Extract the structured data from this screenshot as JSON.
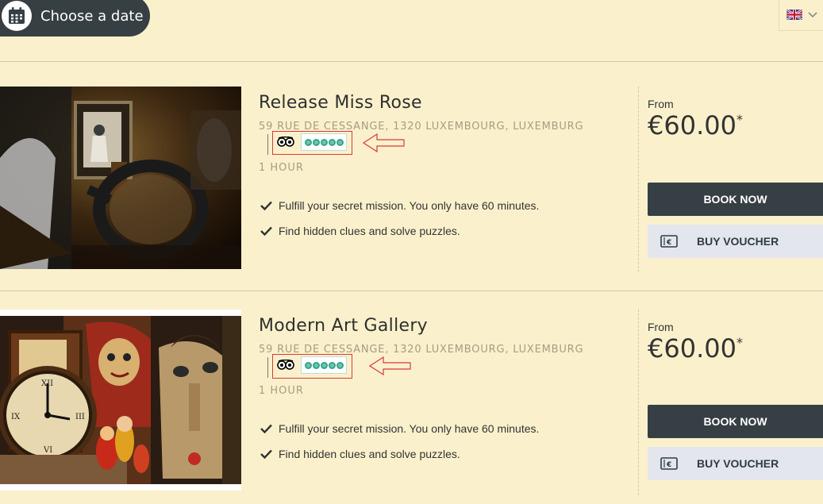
{
  "header": {
    "choose_date_label": "Choose a date",
    "language": "English (UK flag)"
  },
  "rooms": [
    {
      "title": "Release Miss Rose",
      "address": "59 RUE DE CESSANGE, 1320 LUXEMBOURG, LUXEMBURG",
      "duration": "1 HOUR",
      "features": [
        "Fulfill your secret mission. You only have 60 minutes.",
        "Find hidden clues and solve puzzles."
      ],
      "from_label": "From",
      "price": "€60.00",
      "price_note": "*",
      "book_label": "BOOK NOW",
      "voucher_label": "BUY VOUCHER",
      "rating_bubbles": 5
    },
    {
      "title": "Modern Art Gallery",
      "address": "59 RUE DE CESSANGE, 1320 LUXEMBOURG, LUXEMBURG",
      "duration": "1 HOUR",
      "features": [
        "Fulfill your secret mission. You only have 60 minutes.",
        "Find hidden clues and solve puzzles."
      ],
      "from_label": "From",
      "price": "€60.00",
      "price_note": "*",
      "book_label": "BOOK NOW",
      "voucher_label": "BUY VOUCHER",
      "rating_bubbles": 5
    }
  ],
  "colors": {
    "background": "#faf1cc",
    "dark": "#363f44",
    "voucher_bg": "#e4e6ee",
    "tripadvisor_green": "#34a58a",
    "annotation_red": "#d83a3a"
  }
}
